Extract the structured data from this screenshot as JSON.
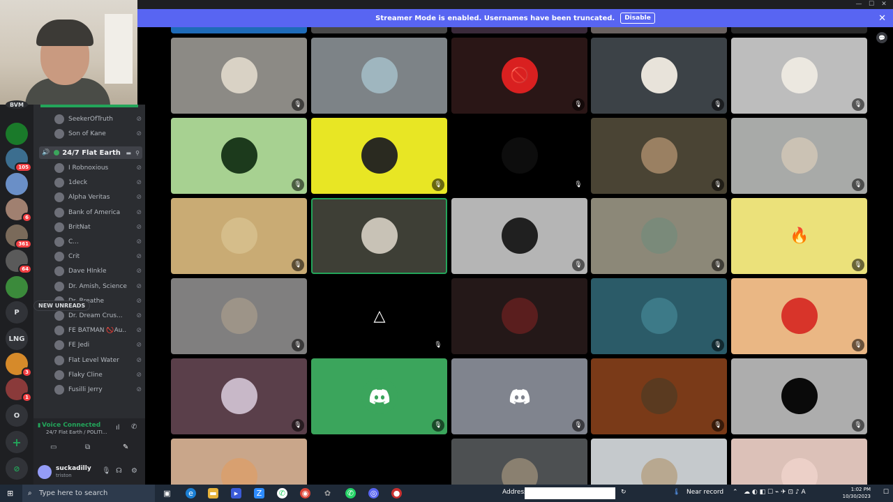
{
  "banner": {
    "message": "Streamer Mode is enabled. Usernames have been truncated.",
    "disable_label": "Disable",
    "close_glyph": "✕"
  },
  "window_controls": [
    "—",
    "☐",
    "✕"
  ],
  "servers": [
    {
      "label": "BVM",
      "color": "#2b2d31",
      "badge": ""
    },
    {
      "label": "",
      "color": "#1a7a2a",
      "badge": ""
    },
    {
      "label": "",
      "color": "#3c6e8f",
      "badge": "105"
    },
    {
      "label": "",
      "color": "#6a8fc7",
      "badge": ""
    },
    {
      "label": "",
      "color": "#a08070",
      "badge": "6"
    },
    {
      "label": "",
      "color": "#7a6a5a",
      "badge": "361"
    },
    {
      "label": "",
      "color": "#5a5a5a",
      "badge": "64"
    },
    {
      "label": "",
      "color": "#3b8a3b",
      "badge": ""
    },
    {
      "label": "P",
      "color": "#313338",
      "badge": ""
    },
    {
      "label": "LNG",
      "color": "#313338",
      "badge": ""
    },
    {
      "label": "",
      "color": "#d68a2a",
      "badge": "3"
    },
    {
      "label": "",
      "color": "#8a3a3a",
      "badge": "1"
    },
    {
      "label": "O",
      "color": "#313338",
      "badge": ""
    }
  ],
  "rail_actions": {
    "add": "+",
    "explore": "⊘"
  },
  "voice_channel": {
    "users_above": [
      {
        "name": "SeekerOfTruth"
      },
      {
        "name": "Son of Kane"
      }
    ],
    "channel_name": "24/7 Flat Earth",
    "users": [
      {
        "name": "I Robnoxious"
      },
      {
        "name": "1deck"
      },
      {
        "name": "Alpha Veritas"
      },
      {
        "name": "Bank of America"
      },
      {
        "name": "BritNat"
      },
      {
        "name": "C..."
      },
      {
        "name": "Crit"
      },
      {
        "name": "Dave HInkle"
      },
      {
        "name": "Dr. Amish, Science ..."
      },
      {
        "name": "Dr. Breathe"
      },
      {
        "name": "Dr. Dream Crus..."
      },
      {
        "name": "FE BATMAN 🚫Au..."
      },
      {
        "name": "FE Jedi"
      },
      {
        "name": "Flat Level Water"
      },
      {
        "name": "Flaky Cline"
      },
      {
        "name": "Fusilli Jerry"
      }
    ],
    "new_unreads": "NEW UNREADS"
  },
  "voice_panel": {
    "status": "Voice Connected",
    "location": "24/7 Flat Earth / POLITI..."
  },
  "user_panel": {
    "name": "suckadilly",
    "tag": "triston"
  },
  "grid": {
    "rows": [
      [
        {
          "bg": "#8c8a85",
          "avatar": "#d9d2c5",
          "glyph": "",
          "mute": "mic-off"
        },
        {
          "bg": "#7d8387",
          "avatar": "#9fb6bf",
          "glyph": "",
          "mute": ""
        },
        {
          "bg": "#2a1616",
          "avatar": "#d92020",
          "glyph": "🚫",
          "mute": "mic-off"
        },
        {
          "bg": "#3c4247",
          "avatar": "#e8e3da",
          "glyph": "",
          "mute": "mic-off"
        },
        {
          "bg": "#bdbdbd",
          "avatar": "#ece8e0",
          "glyph": "",
          "mute": "mic-off"
        }
      ],
      [
        {
          "bg": "#a7d191",
          "avatar": "#1c3a1c",
          "glyph": "",
          "mute": "mic-off"
        },
        {
          "bg": "#e8e624",
          "avatar": "#2a2a20",
          "glyph": "",
          "mute": "mic-off"
        },
        {
          "bg": "#000000",
          "avatar": "#0d0d0d",
          "glyph": "",
          "mute": "mic-off"
        },
        {
          "bg": "#4a4434",
          "avatar": "#9a8062",
          "glyph": "",
          "mute": "mic-off"
        },
        {
          "bg": "#a8aaa8",
          "avatar": "#cbc2b4",
          "glyph": "",
          "mute": "mic-off"
        }
      ],
      [
        {
          "bg": "#c9ab74",
          "avatar": "#d5bd8a",
          "glyph": "",
          "mute": "mic-off"
        },
        {
          "bg": "#3e3f36",
          "avatar": "#c8c2b6",
          "glyph": "",
          "mute": "",
          "speaking": true
        },
        {
          "bg": "#b5b5b5",
          "avatar": "#202020",
          "glyph": "",
          "mute": "mic-off"
        },
        {
          "bg": "#8c8878",
          "avatar": "#7a8a7a",
          "glyph": "",
          "mute": "mic-off"
        },
        {
          "bg": "#ebe17a",
          "avatar": "#ebe17a",
          "glyph": "🔥",
          "mute": "mic-off"
        }
      ],
      [
        {
          "bg": "#807f7f",
          "avatar": "#9d9488",
          "glyph": "",
          "mute": "mic-off"
        },
        {
          "bg": "#000000",
          "avatar": "#000000",
          "glyph": "△",
          "mute": "mic-off"
        },
        {
          "bg": "#241818",
          "avatar": "#5a1e1e",
          "glyph": "",
          "mute": ""
        },
        {
          "bg": "#2b5b68",
          "avatar": "#3d7a88",
          "glyph": "",
          "mute": "mic-off"
        },
        {
          "bg": "#eab784",
          "avatar": "#d8342a",
          "glyph": "",
          "mute": "mic-off"
        }
      ],
      [
        {
          "bg": "#5a3f4a",
          "avatar": "#c8b8c8",
          "glyph": "",
          "mute": "mic-off"
        },
        {
          "bg": "#3ba55c",
          "avatar": "#3ba55c",
          "glyph": "discord",
          "mute": "mic-off"
        },
        {
          "bg": "#80848e",
          "avatar": "#80848e",
          "glyph": "discord",
          "mute": "mic-off"
        },
        {
          "bg": "#7a3a18",
          "avatar": "#5a3a20",
          "glyph": "",
          "mute": "mic-off"
        },
        {
          "bg": "#adadad",
          "avatar": "#0a0a0a",
          "glyph": "",
          "mute": "mic-off"
        }
      ],
      [
        {
          "bg": "#c9a68a",
          "avatar": "#d8a070",
          "glyph": "",
          "mute": ""
        },
        {
          "bg": "#000000",
          "avatar": "#000000",
          "glyph": "",
          "mute": ""
        },
        {
          "bg": "#4d5052",
          "avatar": "#8a8070",
          "glyph": "",
          "mute": ""
        },
        {
          "bg": "#c5c9cc",
          "avatar": "#b8a890",
          "glyph": "",
          "mute": ""
        },
        {
          "bg": "#dcc1b8",
          "avatar": "#ecd0c8",
          "glyph": "",
          "mute": ""
        }
      ]
    ]
  },
  "taskbar": {
    "search_placeholder": "Type here to search",
    "address_label": "Address",
    "near_record": "Near record",
    "time": "1:02 PM",
    "date": "10/30/2023"
  }
}
